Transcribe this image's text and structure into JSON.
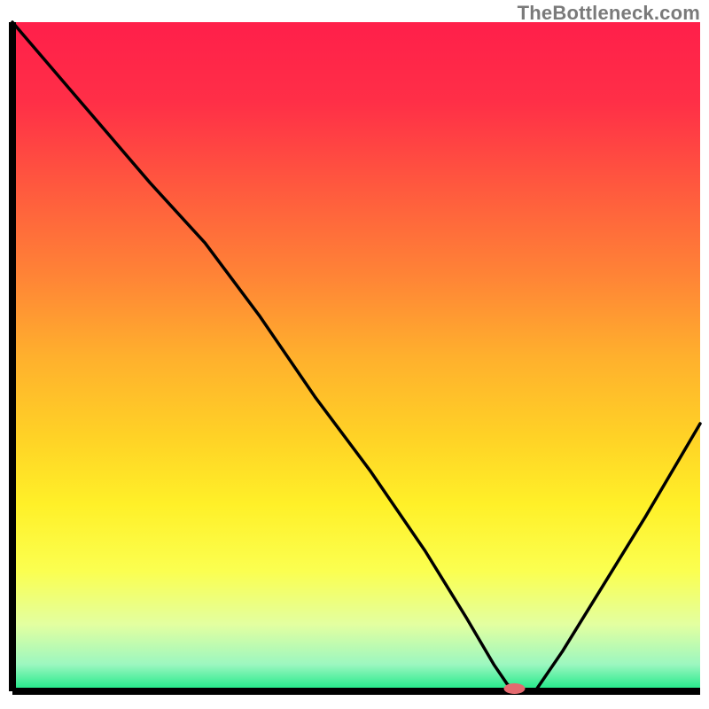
{
  "watermark": "TheBottleneck.com",
  "chart_data": {
    "type": "line",
    "title": "",
    "xlabel": "",
    "ylabel": "",
    "xlim": [
      0,
      100
    ],
    "ylim": [
      0,
      100
    ],
    "grid": false,
    "series": [
      {
        "name": "curve",
        "x": [
          0,
          10,
          20,
          28,
          36,
          44,
          52,
          60,
          66,
          70,
          72,
          74,
          76,
          80,
          86,
          92,
          100
        ],
        "y": [
          100,
          88,
          76,
          67,
          56,
          44,
          33,
          21,
          11,
          4,
          1,
          0,
          0,
          6,
          16,
          26,
          40
        ]
      }
    ],
    "gradient_stops": [
      {
        "offset": 0.0,
        "color": "#ff1f4a"
      },
      {
        "offset": 0.12,
        "color": "#ff2f47"
      },
      {
        "offset": 0.25,
        "color": "#ff5a3e"
      },
      {
        "offset": 0.38,
        "color": "#ff8436"
      },
      {
        "offset": 0.5,
        "color": "#ffb02d"
      },
      {
        "offset": 0.62,
        "color": "#ffd226"
      },
      {
        "offset": 0.72,
        "color": "#fff028"
      },
      {
        "offset": 0.82,
        "color": "#fbff50"
      },
      {
        "offset": 0.9,
        "color": "#e3ffa0"
      },
      {
        "offset": 0.96,
        "color": "#9cf7c0"
      },
      {
        "offset": 1.0,
        "color": "#17e884"
      }
    ],
    "marker": {
      "x": 73,
      "y": 0,
      "rx": 12,
      "ry": 6
    },
    "frame": {
      "left": true,
      "bottom": true,
      "right": false,
      "top": false
    }
  }
}
